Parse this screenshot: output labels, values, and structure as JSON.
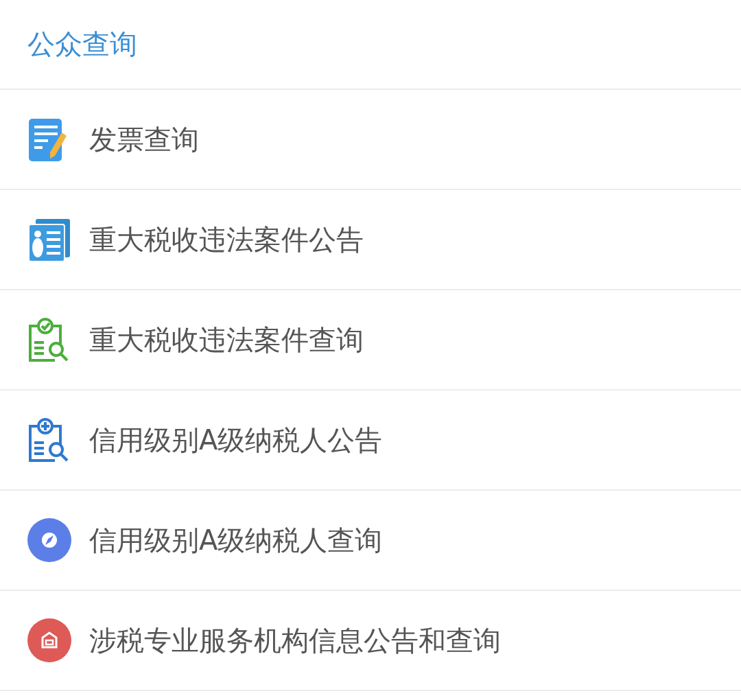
{
  "header": {
    "title": "公众查询"
  },
  "items": [
    {
      "label": "发票查询",
      "kind": "note"
    },
    {
      "label": "重大税收违法案件公告",
      "kind": "card"
    },
    {
      "label": "重大税收违法案件查询",
      "kind": "check"
    },
    {
      "label": "信用级别A级纳税人公告",
      "kind": "plus"
    },
    {
      "label": "信用级别A级纳税人查询",
      "kind": "compass"
    },
    {
      "label": "涉税专业服务机构信息公告和查询",
      "kind": "shop"
    }
  ]
}
